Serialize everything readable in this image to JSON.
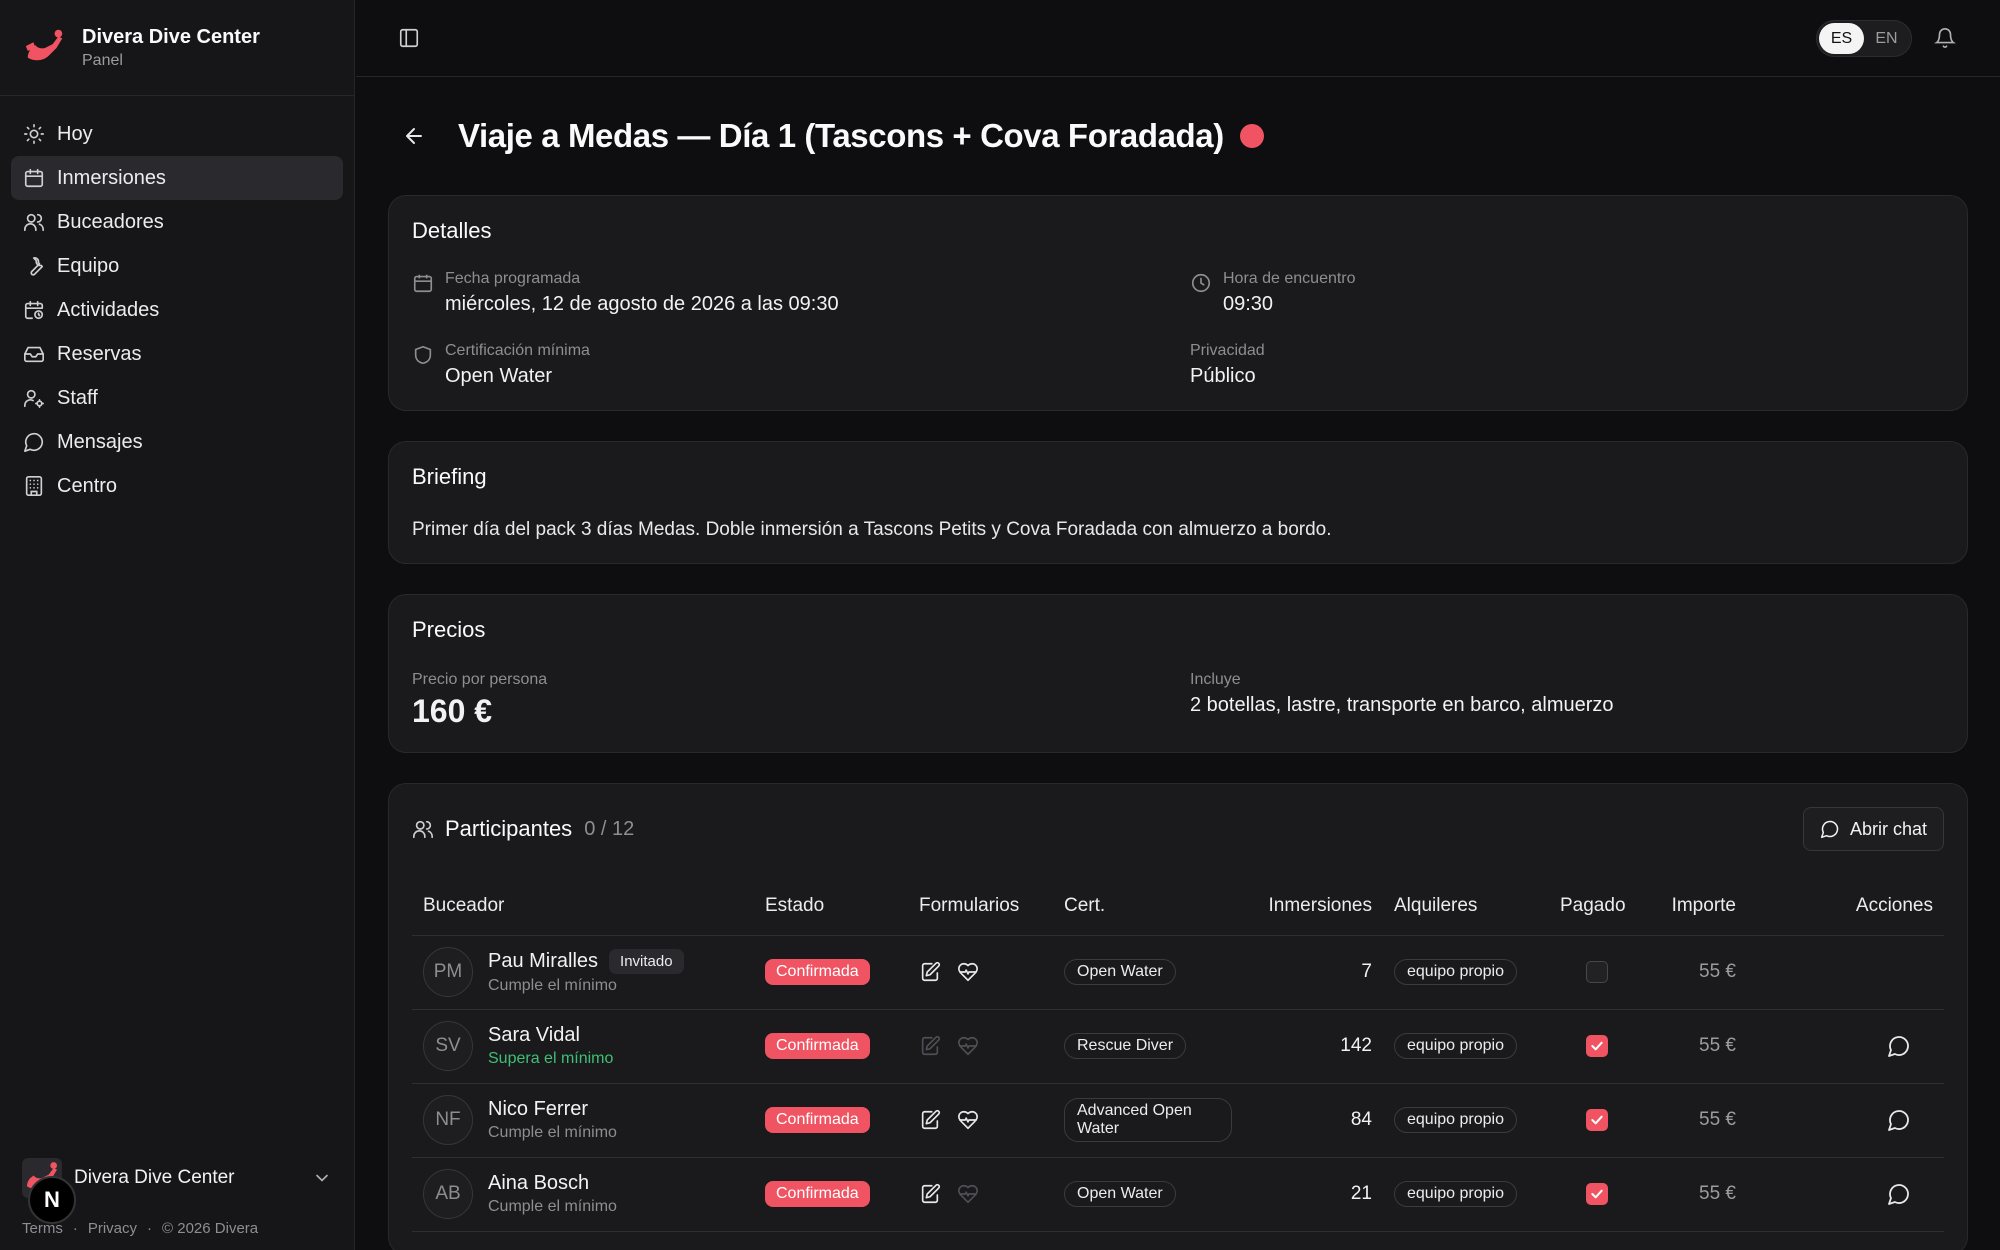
{
  "brand": {
    "name": "Divera Dive Center",
    "subtitle": "Panel"
  },
  "nav": [
    {
      "label": "Hoy",
      "icon": "sun-icon"
    },
    {
      "label": "Inmersiones",
      "icon": "calendar-icon",
      "active": true
    },
    {
      "label": "Buceadores",
      "icon": "users-icon"
    },
    {
      "label": "Equipo",
      "icon": "wrench-icon"
    },
    {
      "label": "Actividades",
      "icon": "calendar-clock-icon"
    },
    {
      "label": "Reservas",
      "icon": "inbox-icon"
    },
    {
      "label": "Staff",
      "icon": "user-cog-icon"
    },
    {
      "label": "Mensajes",
      "icon": "message-icon"
    },
    {
      "label": "Centro",
      "icon": "building-icon"
    }
  ],
  "org": {
    "name": "Divera Dive Center"
  },
  "legal": {
    "terms": "Terms",
    "sep": "·",
    "privacy": "Privacy",
    "copyright": "© 2026 Divera"
  },
  "floating_badge": "N",
  "topbar": {
    "lang_es": "ES",
    "lang_en": "EN",
    "active_lang": "ES"
  },
  "page": {
    "title": "Viaje a Medas — Día 1 (Tascons + Cova Foradada)",
    "status_color": "#f05463"
  },
  "details": {
    "title": "Detalles",
    "date_label": "Fecha programada",
    "date_value": "miércoles, 12 de agosto de 2026 a las 09:30",
    "meet_label": "Hora de encuentro",
    "meet_value": "09:30",
    "cert_label": "Certificación mínima",
    "cert_value": "Open Water",
    "privacy_label": "Privacidad",
    "privacy_value": "Público"
  },
  "briefing": {
    "title": "Briefing",
    "text": "Primer día del pack 3 días Medas. Doble inmersión a Tascons Petits y Cova Foradada con almuerzo a bordo."
  },
  "pricing": {
    "title": "Precios",
    "price_label": "Precio por persona",
    "price_value": "160 €",
    "includes_label": "Incluye",
    "includes_value": "2 botellas, lastre, transporte en barco, almuerzo"
  },
  "participants": {
    "title": "Participantes",
    "count": "0 / 12",
    "chat_button": "Abrir chat",
    "columns": [
      "Buceador",
      "Estado",
      "Formularios",
      "Cert.",
      "Inmersiones",
      "Alquileres",
      "Pagado",
      "Importe",
      "Acciones"
    ],
    "rows": [
      {
        "initials": "PM",
        "name": "Pau Miralles",
        "tag": "Invitado",
        "sub": "Cumple el mínimo",
        "sub_good": false,
        "status": "Confirmada",
        "form1": true,
        "form2": true,
        "cert": "Open Water",
        "dives": "7",
        "rentals": "equipo propio",
        "paid": false,
        "amount": "55 €",
        "has_action": false
      },
      {
        "initials": "SV",
        "name": "Sara Vidal",
        "tag": "",
        "sub": "Supera el mínimo",
        "sub_good": true,
        "status": "Confirmada",
        "form1": false,
        "form2": false,
        "cert": "Rescue Diver",
        "dives": "142",
        "rentals": "equipo propio",
        "paid": true,
        "amount": "55 €",
        "has_action": true
      },
      {
        "initials": "NF",
        "name": "Nico Ferrer",
        "tag": "",
        "sub": "Cumple el mínimo",
        "sub_good": false,
        "status": "Confirmada",
        "form1": true,
        "form2": true,
        "cert": "Advanced Open Water",
        "dives": "84",
        "rentals": "equipo propio",
        "paid": true,
        "amount": "55 €",
        "has_action": true
      },
      {
        "initials": "AB",
        "name": "Aina Bosch",
        "tag": "",
        "sub": "Cumple el mínimo",
        "sub_good": false,
        "status": "Confirmada",
        "form1": true,
        "form2": false,
        "cert": "Open Water",
        "dives": "21",
        "rentals": "equipo propio",
        "paid": true,
        "amount": "55 €",
        "has_action": true
      }
    ]
  },
  "colors": {
    "accent": "#f05463",
    "good": "#3fbf74",
    "background": "#0e0e10",
    "card": "#1a1a1d"
  }
}
